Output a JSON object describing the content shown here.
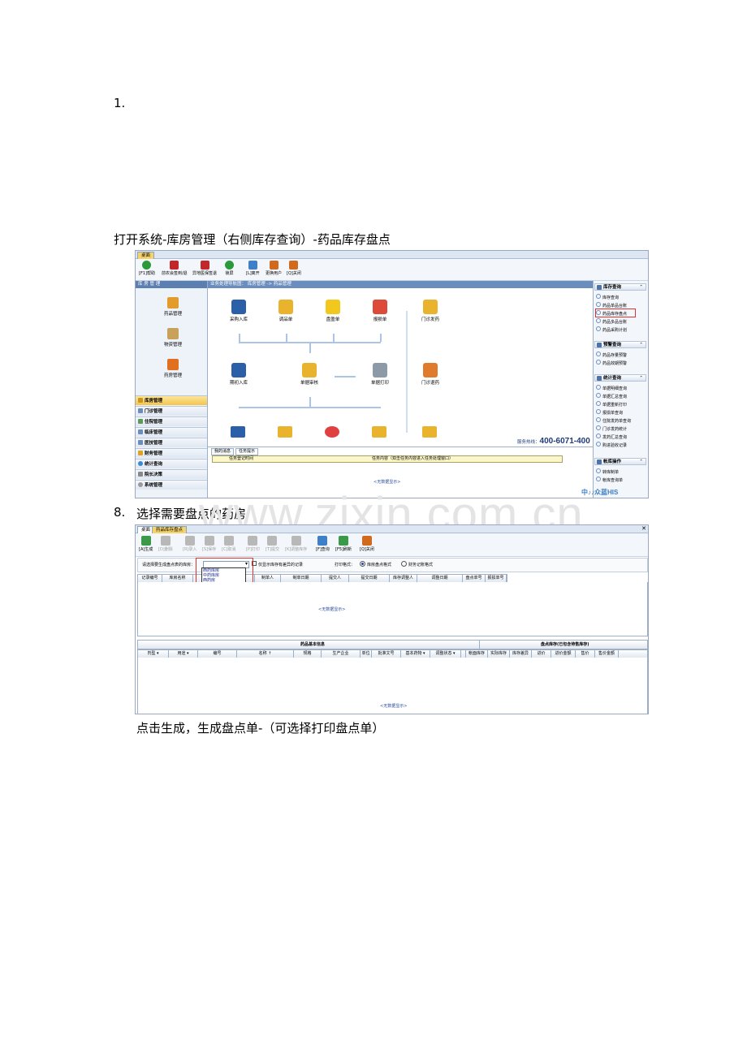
{
  "doc": {
    "step1_number": "1.",
    "intro_text": "打开系统-库房管理（右侧库存查询）-药品库存盘点",
    "step8_number": "8.",
    "step8_text": "选择需要盘点的药房",
    "final_text": "点击生成，生成盘点单-（可选择打印盘点单）",
    "watermark": "www.zixin.com.cn"
  },
  "shot1": {
    "tab": "桌面",
    "toolbar": [
      "[F1]帮助",
      "前农会签到/退",
      "异地医保签退",
      "锁屏",
      "[L]离开",
      "更换用户",
      "[Q]关闭"
    ],
    "left_header": "库 房 管 理",
    "modules": [
      "药品管理",
      "物资管理",
      "药房管理"
    ],
    "nav": [
      "库房管理",
      "门诊管理",
      "住院管理",
      "临床管理",
      "医技管理",
      "财务管理",
      "统计查询",
      "院长决策",
      "系统管理"
    ],
    "center_header": "业务处理导航图：  库房管理 -> 药品管理",
    "flow": {
      "purchase_in": "采购入库",
      "stock_transfer": "调品单",
      "inventory_sheet": "盘盈单",
      "loss_sheet": "报损单",
      "outpatient_dispense": "门诊发药",
      "retire_in": "期初入库",
      "doc_review": "单据审核",
      "doc_print": "单据打印",
      "outpatient_return": "门诊退药"
    },
    "hotline_label": "服务热线：",
    "hotline_number": "400-6071-400",
    "bottom_tabs": [
      "我的消息",
      "任务提示"
    ],
    "task_cols": [
      "任务登记时间",
      "任务内容（双击任务内容进入任务处理窗口）"
    ],
    "no_data": "<无数据显示>",
    "right": {
      "sec1": "库存查询",
      "sec1_items": [
        "库存查询",
        "药品单品台账",
        "药品库存盘点",
        "药品多品台账",
        "药品采购计划"
      ],
      "sec2": "预警查询",
      "sec2_items": [
        "药品存量预警",
        "药品效期预警"
      ],
      "sec3": "统计查询",
      "sec3_items": [
        "单据明细查询",
        "单据汇总查询",
        "单据重新打印",
        "报损单查询",
        "住院发药单查询",
        "门诊发药统计",
        "发药汇总查询",
        "购进验收记录"
      ],
      "sec4": "帐库操作",
      "sec4_items": [
        "转库制单",
        "帐库查询单"
      ]
    },
    "logo": "中♪♪众蓝HIS"
  },
  "shot2": {
    "tabs": [
      "桌面",
      "药品库存盘点"
    ],
    "toolbar": [
      {
        "label": "[A]生成",
        "enabled": true
      },
      {
        "label": "[D]删除",
        "enabled": false
      },
      {
        "label": "[R]录入",
        "enabled": false
      },
      {
        "label": "[S]保存",
        "enabled": false
      },
      {
        "label": "[C]取消",
        "enabled": false
      },
      {
        "label": "[P]打印",
        "enabled": false
      },
      {
        "label": "[T]提交",
        "enabled": false
      },
      {
        "label": "[K]调整库存",
        "enabled": false
      },
      {
        "label": "[F]查询",
        "enabled": true
      },
      {
        "label": "[F5]刷新",
        "enabled": true
      },
      {
        "label": "[Q]关闭",
        "enabled": true
      }
    ],
    "filter_label": "请选择要生成盘点表的库房：",
    "only_diff": "仅显示库存有差异的记录",
    "print_format_label": "打印格式：",
    "print_opt1": "库房盘点格式",
    "print_opt2": "财务记账格式",
    "dropdown_options": [
      "西药库房",
      "中药库房",
      "西药房",
      "药房"
    ],
    "grid1_cols": [
      "记录编号",
      "库房名称",
      "",
      "",
      "制单人",
      "制单日期",
      "提交人",
      "提交日期",
      "库存调整人",
      "调整日期",
      "盘点单号",
      "报损单号"
    ],
    "no_data": "<无数据显示>",
    "group_left": "药品基本信息",
    "group_right": "盘点库存(已包含待售库存)",
    "grid2_cols": [
      "剂型",
      "用途",
      "编号",
      "名称 ↑",
      "规格",
      "生产企业",
      "单位",
      "批准文号",
      "基本药物",
      "调整状态",
      "",
      "帐面库存",
      "实际库存",
      "库存差异",
      "进价",
      "进价金额",
      "售价",
      "售价金额"
    ]
  }
}
